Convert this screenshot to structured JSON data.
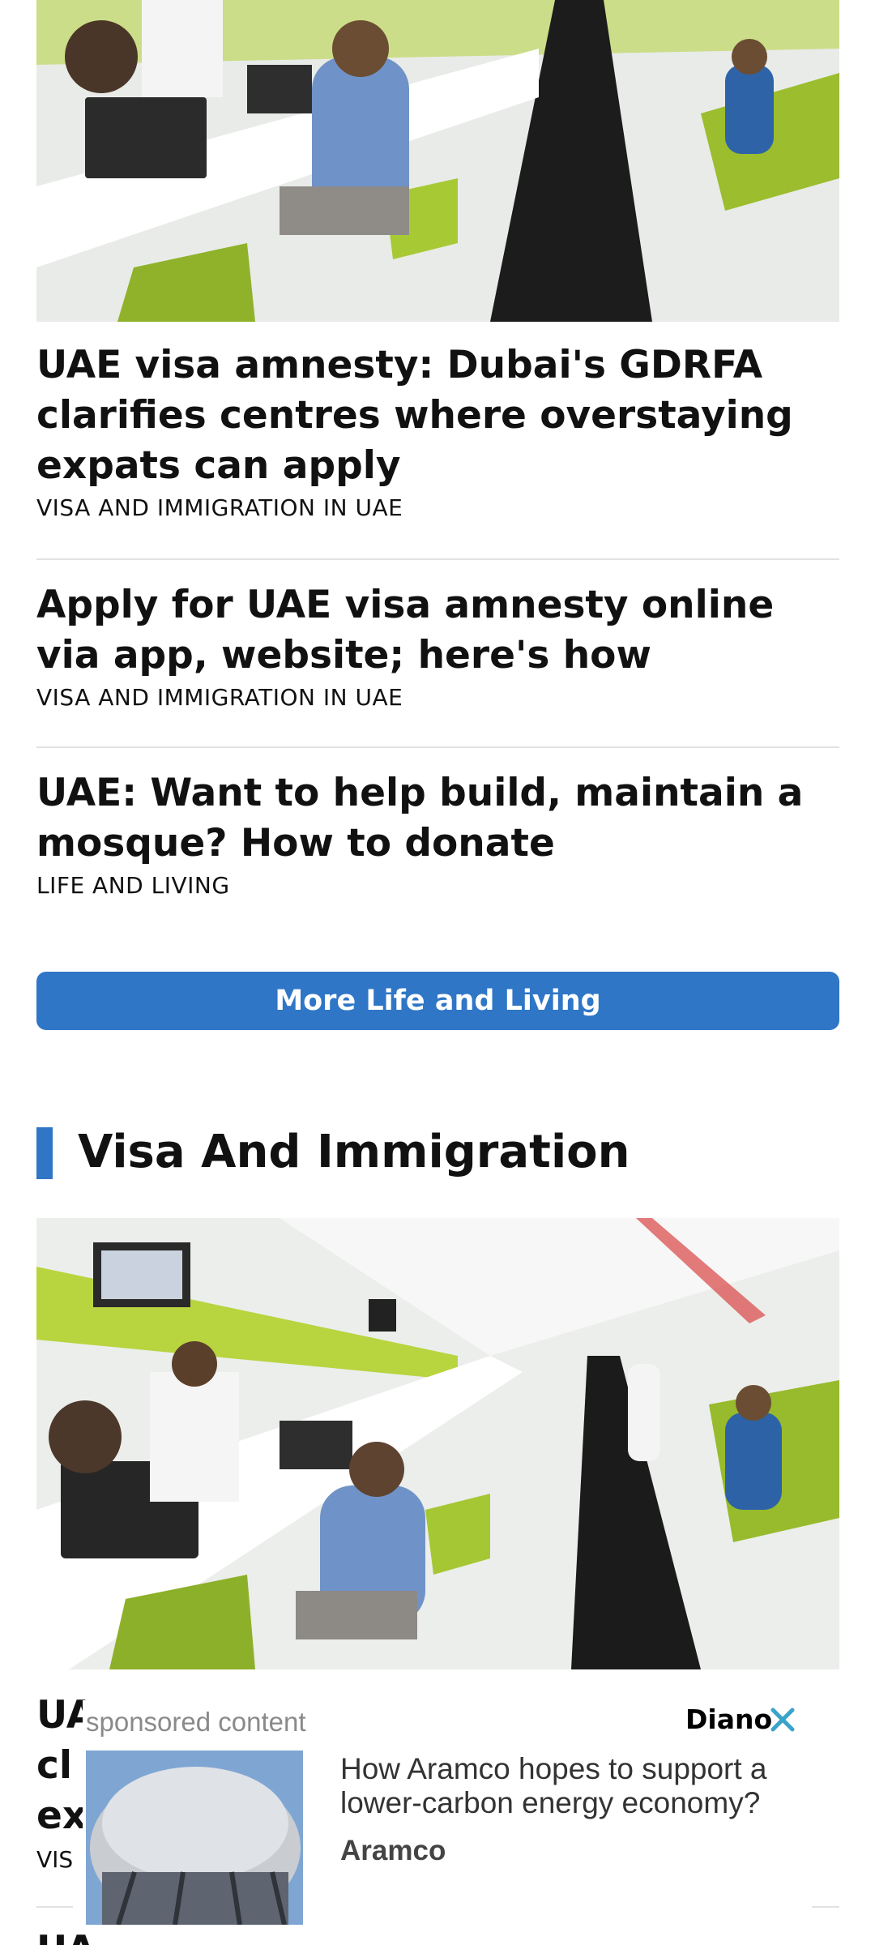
{
  "articles": [
    {
      "headline": "UAE visa amnesty: Dubai's GDRFA clarifies centres where overstaying expats can apply",
      "category": "VISA AND IMMIGRATION IN UAE"
    },
    {
      "headline": "Apply for UAE visa amnesty online via app, website; here's how",
      "category": "VISA AND IMMIGRATION IN UAE"
    },
    {
      "headline": "UAE: Want to help build, maintain a mosque? How to donate",
      "category": "LIFE AND LIVING"
    }
  ],
  "more_button": {
    "label": "More Life and Living"
  },
  "section": {
    "title": "Visa And Immigration"
  },
  "section_article_peek": {
    "line1": "UA",
    "line1_right": "",
    "line2": "cl",
    "line3": "ex",
    "category": "VIS"
  },
  "ad": {
    "label": "sponsored content",
    "brand": "Diano",
    "title": "How Aramco hopes to support a lower-carbon energy economy?",
    "sponsor": "Aramco",
    "close_icon": "close-icon"
  },
  "colors": {
    "accent": "#2f76c6",
    "divider": "#e2e2e2",
    "close": "#3aa3c9"
  }
}
